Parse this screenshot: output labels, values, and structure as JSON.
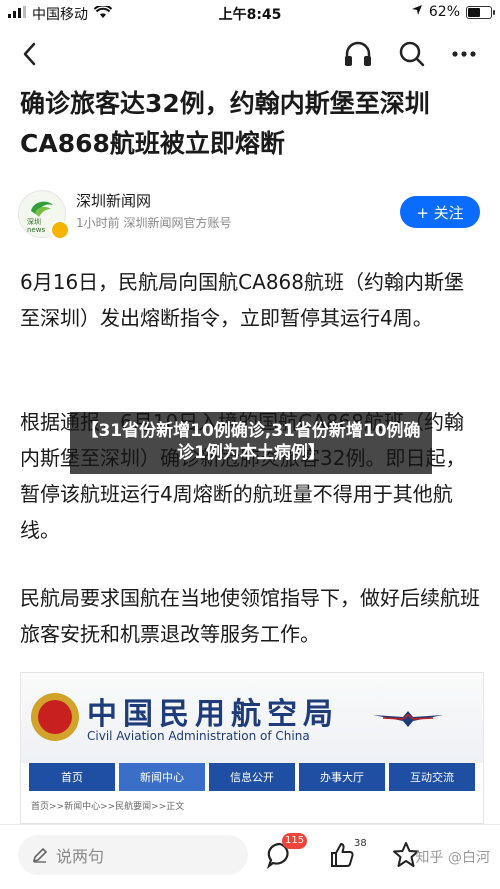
{
  "status_bar": {
    "carrier": "中国移动",
    "time": "上午8:45",
    "battery": "62%",
    "battery_level": 0.62
  },
  "article": {
    "title": "确诊旅客达32例，约翰内斯堡至深圳CA868航班被立即熔断",
    "author": {
      "name": "深圳新闻网",
      "meta": "1小时前 深圳新闻网官方账号",
      "avatar_text": "深圳\nnews",
      "follow_label": "+ 关注"
    },
    "paragraphs": [
      "6月16日，民航局向国航CA868航班（约翰内斯堡至深圳）发出熔断指令，立即暂停其运行4周。",
      "根据通报，6月10日入境的国航CA868航班（约翰内斯堡至深圳）确诊新冠肺炎旅客32例。即日起，暂停该航班运行4周熔断的航班量不得用于其他航线。",
      "民航局要求国航在当地使领馆指导下，做好后续航班旅客安抚和机票退改等服务工作。"
    ],
    "overlay_banner": "【31省份新增10例确诊,31省份新增10例确诊1例为本土病例】",
    "image": {
      "title_cn": "中国民用航空局",
      "title_en": "Civil Aviation Administration of China",
      "nav_tabs": [
        "首页",
        "新闻中心",
        "信息公开",
        "办事大厅",
        "互动交流"
      ],
      "active_tab": 1,
      "breadcrumb": "首页>>新闻中心>>民航要闻>>正文"
    }
  },
  "bottom_bar": {
    "comment_placeholder": "说两句",
    "comment_count": "115",
    "like_count": "38",
    "watermark": "知乎 @白河"
  }
}
